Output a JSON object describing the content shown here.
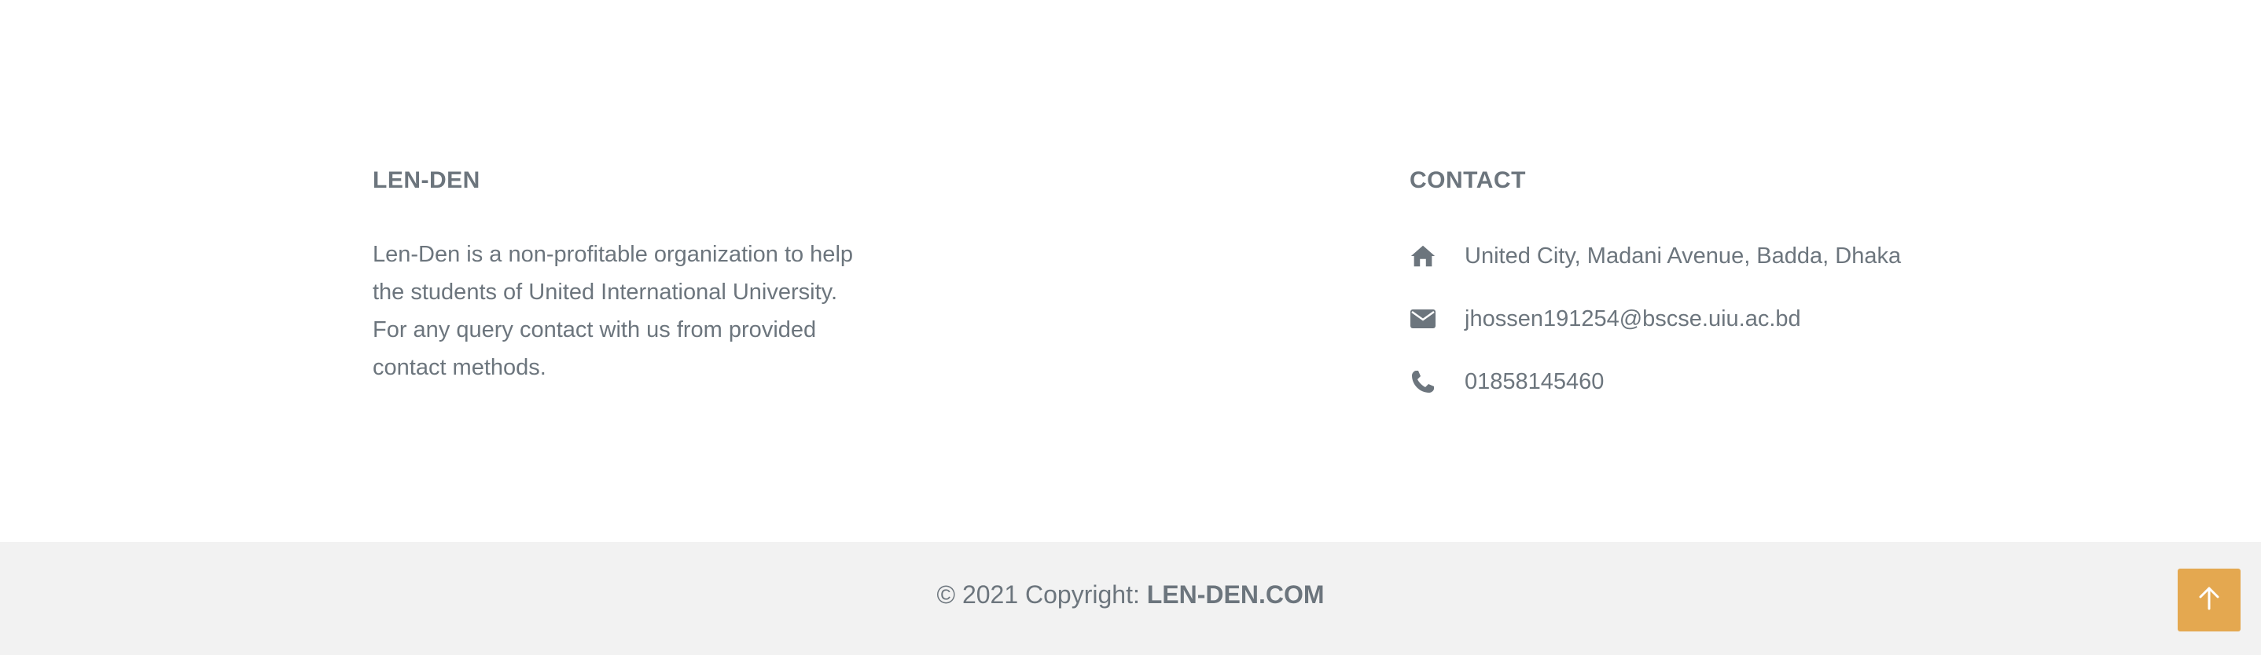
{
  "about": {
    "title": "LEN-DEN",
    "description": "Len-Den is a non-profitable organization to help the students of United International University. For any query contact with us from provided contact methods."
  },
  "contact": {
    "title": "CONTACT",
    "items": [
      {
        "icon": "home-icon",
        "text": "United City, Madani Avenue, Badda, Dhaka"
      },
      {
        "icon": "envelope-icon",
        "text": "jhossen191254@bscse.uiu.ac.bd"
      },
      {
        "icon": "phone-icon",
        "text": "01858145460"
      }
    ]
  },
  "copyright": {
    "prefix": "© 2021 Copyright: ",
    "brand": "LEN-DEN.COM"
  },
  "back_to_top": {
    "icon": "arrow-up-icon"
  },
  "colors": {
    "text": "#6c757d",
    "copyright_bar": "#f2f2f2",
    "back_to_top": "#e4a850"
  }
}
